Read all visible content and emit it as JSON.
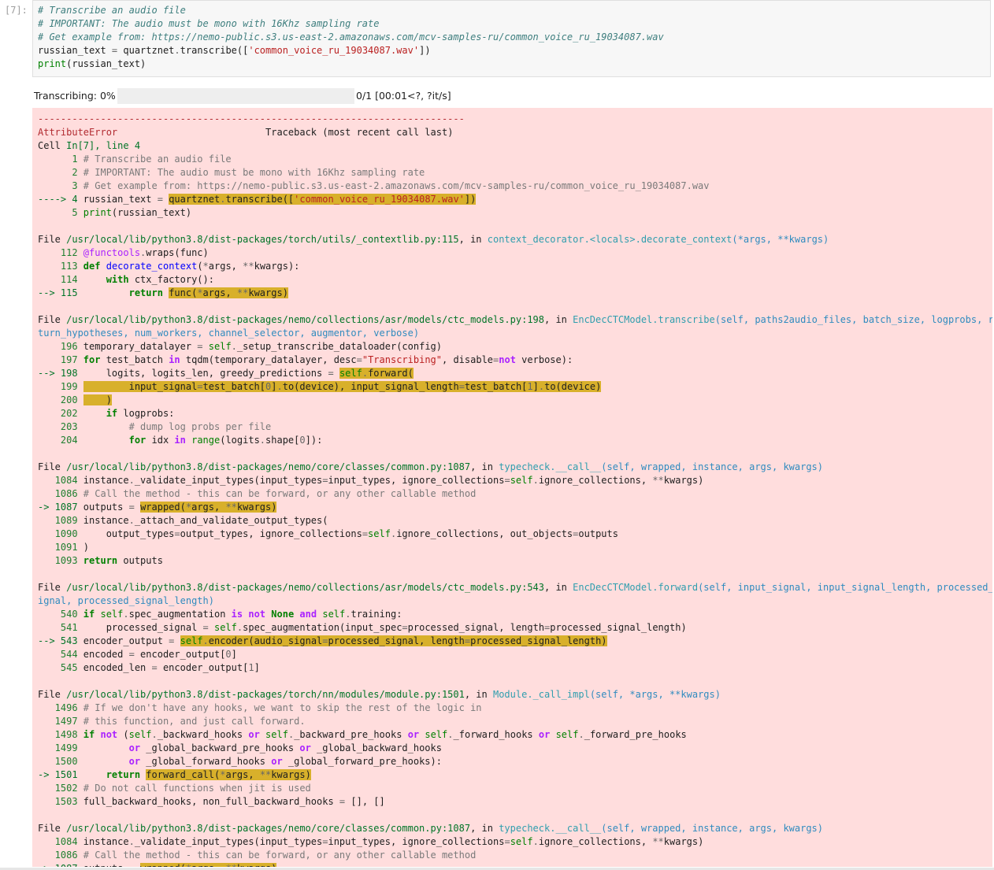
{
  "cell": {
    "prompt": "[7]:",
    "code_lines": [
      "# Transcribe an audio file",
      "# IMPORTANT: The audio must be mono with 16Khz sampling rate",
      "# Get example from: https://nemo-public.s3.us-east-2.amazonaws.com/mcv-samples-ru/common_voice_ru_19034087.wav",
      "russian_text = quartznet.transcribe(['common_voice_ru_19034087.wav'])",
      "print(russian_text)"
    ]
  },
  "progress": {
    "label": "Transcribing: 0%",
    "fraction": 0.0,
    "stats": "0/1 [00:01<?, ?it/s]",
    "fill_color": "#4caf50"
  },
  "error": {
    "background": "#ffdddd",
    "highlight_color": "#d8b02b",
    "separator": "---------------------------------------------------------------------------",
    "exception_name": "AttributeError",
    "traceback_header": "Traceback (most recent call last)",
    "cell_ref": {
      "prefix": "Cell ",
      "name": "In[7], line 4"
    },
    "blocks": [
      {
        "path": "/usr/local/lib/python3.8/dist-packages/torch/utils/_contextlib.py:115",
        "func": "context_decorator.<locals>.decorate_context",
        "args": "(*args, **kwargs)"
      },
      {
        "path": "/usr/local/lib/python3.8/dist-packages/nemo/collections/asr/models/ctc_models.py:198",
        "func": "EncDecCTCModel.transcribe",
        "args_line1": "(self, paths2audio_files, batch_size, logprobs, re",
        "args_line2": "turn_hypotheses, num_workers, channel_selector, augmentor, verbose)"
      },
      {
        "path": "/usr/local/lib/python3.8/dist-packages/nemo/core/classes/common.py:1087",
        "func": "typecheck.__call__",
        "args": "(self, wrapped, instance, args, kwargs)"
      },
      {
        "path": "/usr/local/lib/python3.8/dist-packages/nemo/collections/asr/models/ctc_models.py:543",
        "func": "EncDecCTCModel.forward",
        "args_line1": "(self, input_signal, input_signal_length, processed_s",
        "args_line2": "ignal, processed_signal_length)"
      },
      {
        "path": "/usr/local/lib/python3.8/dist-packages/torch/nn/modules/module.py:1501",
        "func": "Module._call_impl",
        "args": "(self, *args, **kwargs)"
      },
      {
        "path": "/usr/local/lib/python3.8/dist-packages/nemo/core/classes/common.py:1087",
        "func": "typecheck.__call__",
        "args": "(self, wrapped, instance, args, kwargs)"
      }
    ]
  }
}
